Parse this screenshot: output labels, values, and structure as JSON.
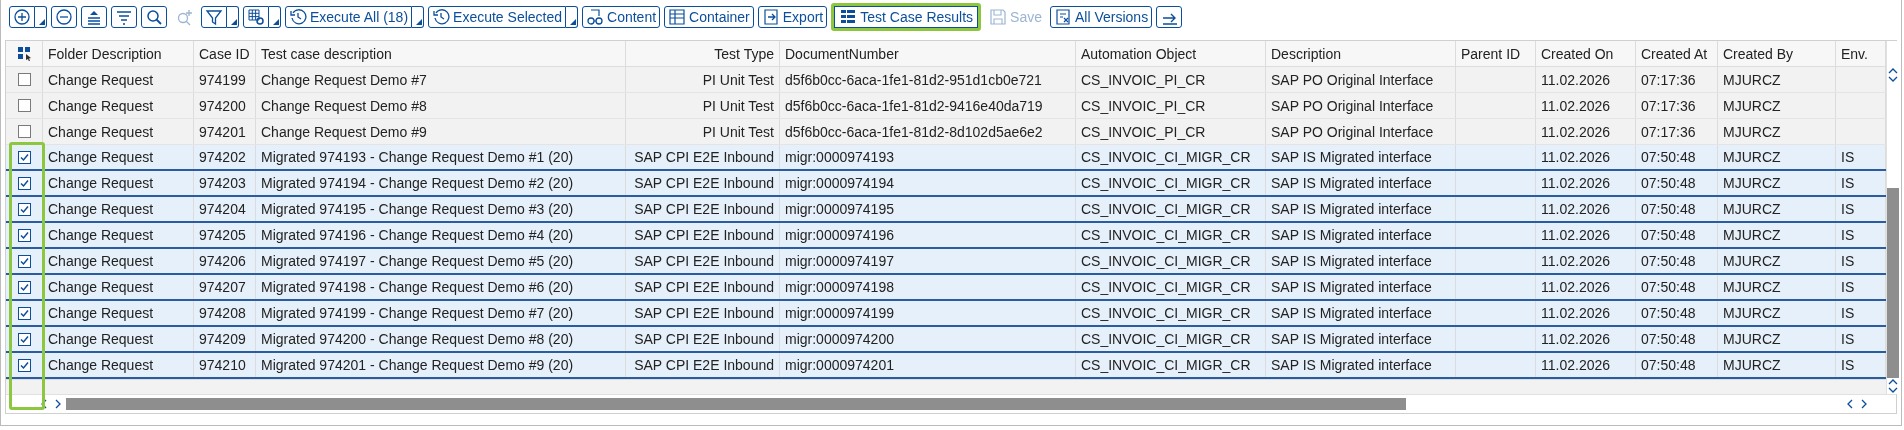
{
  "toolbar": [
    {
      "kind": "icon",
      "dropdown": true,
      "disabled": false,
      "highlighted": false
    },
    {
      "kind": "icon",
      "dropdown": false,
      "disabled": false,
      "highlighted": false
    },
    {
      "kind": "icon",
      "dropdown": false,
      "disabled": false,
      "highlighted": false
    },
    {
      "kind": "icon",
      "dropdown": false,
      "disabled": false,
      "highlighted": false
    },
    {
      "kind": "icon",
      "dropdown": false,
      "disabled": false,
      "highlighted": false
    },
    {
      "kind": "icon",
      "dropdown": false,
      "disabled": true,
      "highlighted": false
    },
    {
      "kind": "icon",
      "dropdown": true,
      "disabled": false,
      "highlighted": false
    },
    {
      "kind": "icon",
      "dropdown": true,
      "disabled": false,
      "highlighted": false
    },
    {
      "kind": "text",
      "label": "Execute All (18)",
      "dropdown": true,
      "disabled": false,
      "highlighted": false
    },
    {
      "kind": "text",
      "label": "Execute Selected",
      "dropdown": true,
      "disabled": false,
      "highlighted": false
    },
    {
      "kind": "text",
      "label": "Content",
      "dropdown": false,
      "disabled": false,
      "highlighted": false
    },
    {
      "kind": "text",
      "label": "Container",
      "dropdown": false,
      "disabled": false,
      "highlighted": false
    },
    {
      "kind": "text",
      "label": "Export",
      "dropdown": false,
      "disabled": false,
      "highlighted": false
    },
    {
      "kind": "text",
      "label": "Test Case Results",
      "dropdown": false,
      "disabled": false,
      "highlighted": true
    },
    {
      "kind": "text",
      "label": "Save",
      "dropdown": false,
      "disabled": true,
      "highlighted": false
    },
    {
      "kind": "text",
      "label": "All Versions",
      "dropdown": false,
      "disabled": false,
      "highlighted": false
    },
    {
      "kind": "icon",
      "dropdown": false,
      "disabled": false,
      "highlighted": false
    }
  ],
  "table": {
    "checkbox_column_highlighted": true,
    "columns": [
      "Folder Description",
      "Case ID",
      "Test case description",
      "Test Type",
      "DocumentNumber",
      "Automation Object",
      "Description",
      "Parent ID",
      "Created On",
      "Created At",
      "Created By",
      "Env."
    ],
    "rows": [
      {
        "checked": false,
        "cells": [
          "Change Request",
          "974199",
          "Change Request Demo #7",
          "PI Unit Test",
          "d5f6b0cc-6aca-1fe1-81d2-951d1cb0e721",
          "CS_INVOIC_PI_CR",
          "SAP PO Original Interface",
          null,
          "11.02.2026",
          "07:17:36",
          "MJURCZ",
          null
        ]
      },
      {
        "checked": false,
        "cells": [
          "Change Request",
          "974200",
          "Change Request Demo #8",
          "PI Unit Test",
          "d5f6b0cc-6aca-1fe1-81d2-9416e40da719",
          "CS_INVOIC_PI_CR",
          "SAP PO Original Interface",
          null,
          "11.02.2026",
          "07:17:36",
          "MJURCZ",
          null
        ]
      },
      {
        "checked": false,
        "cells": [
          "Change Request",
          "974201",
          "Change Request Demo #9",
          "PI Unit Test",
          "d5f6b0cc-6aca-1fe1-81d2-8d102d5ae6e2",
          "CS_INVOIC_PI_CR",
          "SAP PO Original Interface",
          null,
          "11.02.2026",
          "07:17:36",
          "MJURCZ",
          null
        ]
      },
      {
        "checked": true,
        "cells": [
          "Change Request",
          "974202",
          "Migrated 974193 - Change Request Demo #1 (20)",
          "SAP CPI E2E Inbound",
          "migr:0000974193",
          "CS_INVOIC_CI_MIGR_CR",
          "SAP IS Migrated interface",
          null,
          "11.02.2026",
          "07:50:48",
          "MJURCZ",
          "IS"
        ]
      },
      {
        "checked": true,
        "cells": [
          "Change Request",
          "974203",
          "Migrated 974194 - Change Request Demo #2 (20)",
          "SAP CPI E2E Inbound",
          "migr:0000974194",
          "CS_INVOIC_CI_MIGR_CR",
          "SAP IS Migrated interface",
          null,
          "11.02.2026",
          "07:50:48",
          "MJURCZ",
          "IS"
        ]
      },
      {
        "checked": true,
        "cells": [
          "Change Request",
          "974204",
          "Migrated 974195 - Change Request Demo #3 (20)",
          "SAP CPI E2E Inbound",
          "migr:0000974195",
          "CS_INVOIC_CI_MIGR_CR",
          "SAP IS Migrated interface",
          null,
          "11.02.2026",
          "07:50:48",
          "MJURCZ",
          "IS"
        ]
      },
      {
        "checked": true,
        "cells": [
          "Change Request",
          "974205",
          "Migrated 974196 - Change Request Demo #4 (20)",
          "SAP CPI E2E Inbound",
          "migr:0000974196",
          "CS_INVOIC_CI_MIGR_CR",
          "SAP IS Migrated interface",
          null,
          "11.02.2026",
          "07:50:48",
          "MJURCZ",
          "IS"
        ]
      },
      {
        "checked": true,
        "cells": [
          "Change Request",
          "974206",
          "Migrated 974197 - Change Request Demo #5 (20)",
          "SAP CPI E2E Inbound",
          "migr:0000974197",
          "CS_INVOIC_CI_MIGR_CR",
          "SAP IS Migrated interface",
          null,
          "11.02.2026",
          "07:50:48",
          "MJURCZ",
          "IS"
        ]
      },
      {
        "checked": true,
        "cells": [
          "Change Request",
          "974207",
          "Migrated 974198 - Change Request Demo #6 (20)",
          "SAP CPI E2E Inbound",
          "migr:0000974198",
          "CS_INVOIC_CI_MIGR_CR",
          "SAP IS Migrated interface",
          null,
          "11.02.2026",
          "07:50:48",
          "MJURCZ",
          "IS"
        ]
      },
      {
        "checked": true,
        "cells": [
          "Change Request",
          "974208",
          "Migrated 974199 - Change Request Demo #7 (20)",
          "SAP CPI E2E Inbound",
          "migr:0000974199",
          "CS_INVOIC_CI_MIGR_CR",
          "SAP IS Migrated interface",
          null,
          "11.02.2026",
          "07:50:48",
          "MJURCZ",
          "IS"
        ]
      },
      {
        "checked": true,
        "cells": [
          "Change Request",
          "974209",
          "Migrated 974200 - Change Request Demo #8 (20)",
          "SAP CPI E2E Inbound",
          "migr:0000974200",
          "CS_INVOIC_CI_MIGR_CR",
          "SAP IS Migrated interface",
          null,
          "11.02.2026",
          "07:50:48",
          "MJURCZ",
          "IS"
        ]
      },
      {
        "checked": true,
        "cells": [
          "Change Request",
          "974210",
          "Migrated 974201 - Change Request Demo #9 (20)",
          "SAP CPI E2E Inbound",
          "migr:0000974201",
          "CS_INVOIC_CI_MIGR_CR",
          "SAP IS Migrated interface",
          null,
          "11.02.2026",
          "07:50:48",
          "MJURCZ",
          "IS"
        ]
      }
    ]
  }
}
